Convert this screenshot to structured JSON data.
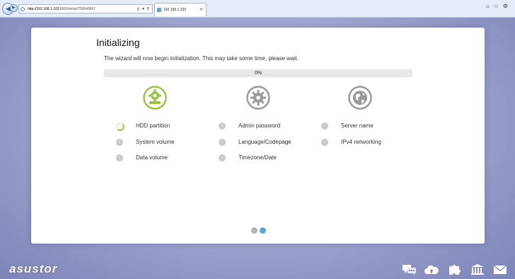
{
  "browser": {
    "address_host": "http://192.168.1.103",
    "address_path": ":8000/initial/?58049667",
    "tab_title": "192.168.1.103",
    "tools": "ρ ▾ ¢"
  },
  "dialog": {
    "title": "Initializing",
    "subtitle": "The wizard will now begin initialization. This may take some time, please wait.",
    "progress_label": "0%",
    "progress_value": 0,
    "columns": [
      {
        "icon": "disk-gear-icon",
        "status": "active"
      },
      {
        "icon": "gear-icon",
        "status": "pending"
      },
      {
        "icon": "globe-icon",
        "status": "pending"
      }
    ],
    "steps": [
      {
        "label": "HDD partition",
        "status": "in-progress"
      },
      {
        "label": "System volume",
        "status": "pending"
      },
      {
        "label": "Data volume",
        "status": "pending"
      },
      {
        "label": "Admin password",
        "status": "pending"
      },
      {
        "label": "Language/Codepage",
        "status": "pending"
      },
      {
        "label": "Timezone/Date",
        "status": "pending"
      },
      {
        "label": "Server name",
        "status": "pending"
      },
      {
        "label": "IPv4 networking",
        "status": "pending"
      }
    ],
    "pager": {
      "pages": 2,
      "current": 2
    }
  },
  "footer": {
    "logo": "asustor",
    "icons": [
      "chat-icon",
      "cloud-icon",
      "puzzle-icon",
      "bank-icon",
      "mail-icon"
    ]
  },
  "colors": {
    "accent_green": "#9bc34a",
    "pending_gray": "#c9c9c9",
    "pager_blue": "#5aa9d6"
  }
}
